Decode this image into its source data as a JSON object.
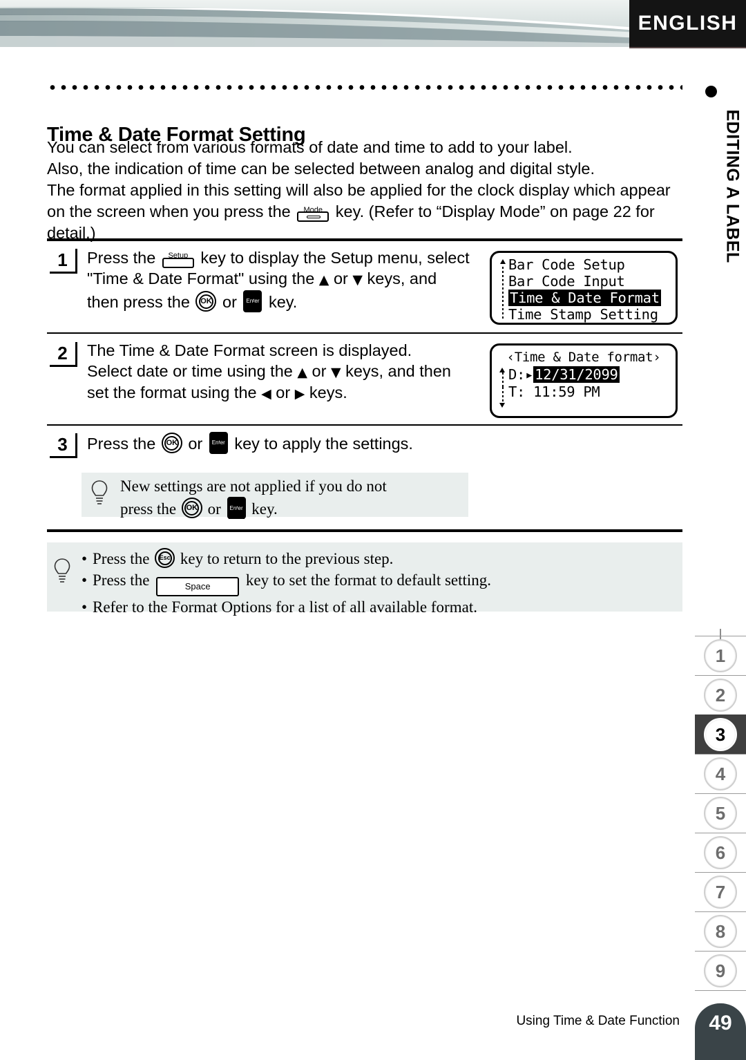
{
  "header": {
    "language_badge": "ENGLISH"
  },
  "sidebar": {
    "chapter_label": "EDITING A LABEL",
    "tabs": [
      {
        "label": "1",
        "active": false
      },
      {
        "label": "2",
        "active": false
      },
      {
        "label": "3",
        "active": true
      },
      {
        "label": "4",
        "active": false
      },
      {
        "label": "5",
        "active": false
      },
      {
        "label": "6",
        "active": false
      },
      {
        "label": "7",
        "active": false
      },
      {
        "label": "8",
        "active": false
      },
      {
        "label": "9",
        "active": false
      }
    ]
  },
  "page": {
    "title": "Time & Date Format Setting",
    "intro": {
      "line1": "You can select from various formats of date and time to add to your label.",
      "line2": "Also, the indication of time can be selected between analog and digital style.",
      "line3a": "The format applied in this setting will also be applied for the clock display which appear",
      "line3b": "on the screen when you press the",
      "line3c": "key. (Refer to “Display Mode” on page 22 for",
      "line3d": "detail.)"
    },
    "steps": [
      {
        "number": "1",
        "text_a": "Press the",
        "text_b": "key to display the Setup menu, select",
        "text_c": "\"Time & Date Format\" using the",
        "text_d": "or",
        "text_e": "keys, and",
        "text_f": "then press the",
        "text_g": "or",
        "text_h": "key."
      },
      {
        "number": "2",
        "text_a": "The Time & Date Format screen is displayed.",
        "text_b": "Select date or time using the",
        "text_c": "or",
        "text_d": "keys, and then",
        "text_e": "set the format using the",
        "text_f": "or",
        "text_g": "keys."
      },
      {
        "number": "3",
        "text_a": "Press the",
        "text_b": "or",
        "text_c": "key to apply the settings."
      }
    ],
    "keys": {
      "mode": "Mode",
      "setup": "Setup",
      "ok": "OK",
      "enter": "Enter",
      "esc": "Esc",
      "space": "Space"
    },
    "arrows": {
      "up": "▲",
      "down": "▼",
      "left": "◀",
      "right": "▶"
    },
    "lcd_setup": {
      "items": [
        {
          "text": "Bar Code Setup",
          "selected": false
        },
        {
          "text": "Bar Code Input",
          "selected": false
        },
        {
          "text": "Time & Date Format",
          "selected": true
        },
        {
          "text": "Time Stamp Setting",
          "selected": false
        }
      ]
    },
    "lcd_format": {
      "title": "‹Time & Date format›",
      "date_label": "D",
      "date_marker": ":▸",
      "date_value": "12/31/2099",
      "time_label": "T",
      "time_marker": ":",
      "time_value": "11:59 PM"
    },
    "tip_apply": {
      "line1": "New settings are not applied if you do not",
      "line2a": "press the",
      "line2b": "or",
      "line2c": "key."
    },
    "tip_notes": {
      "bullet1a": "Press the",
      "bullet1b": "key to return to the previous step.",
      "bullet2a": "Press the",
      "bullet2b": "key to set the format to default setting.",
      "bullet3": "Refer to the Format Options for a list of all available format."
    }
  },
  "footer": {
    "section": "Using Time & Date Function",
    "page_number": "49"
  },
  "colors": {
    "banner_dark": "#7e9094",
    "banner_light": "#dfe6e5",
    "badge_bg": "#141414",
    "tip_bg": "#e9eeed",
    "tab_active_bg": "#3f3f3f",
    "page_tab_bg": "#3a4448"
  }
}
